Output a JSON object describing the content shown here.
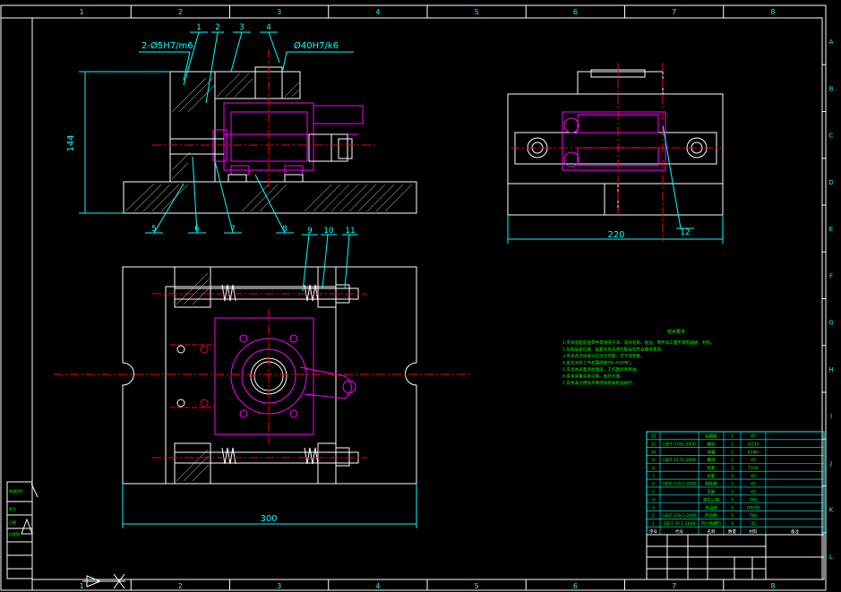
{
  "colors": {
    "background": "#000000",
    "outline": "#ffffff",
    "dimension": "#00ffff",
    "centerline": "#ff0000",
    "part": "#ff00ff",
    "notes": "#00ff00",
    "titleblock": "#00ffff"
  },
  "border_zones": {
    "columns": [
      "1",
      "2",
      "3",
      "4",
      "5",
      "6",
      "7",
      "8"
    ],
    "rows": [
      "A",
      "B",
      "C",
      "D",
      "E",
      "F",
      "G",
      "H",
      "I",
      "J",
      "K",
      "L"
    ]
  },
  "front_view": {
    "fit_left": "2-Ø5H7/m6",
    "fit_right": "Ø40H7/k6",
    "height_dim": "144",
    "balloons_top": [
      "1",
      "2",
      "3",
      "4"
    ],
    "balloons_bottom": [
      "5",
      "6",
      "7",
      "8"
    ]
  },
  "plan_view": {
    "width_dim": "300",
    "balloons": [
      "9",
      "10",
      "11"
    ]
  },
  "side_view": {
    "width_dim": "220",
    "balloon": "12"
  },
  "technical_notes": {
    "title": "技术要求",
    "lines": [
      "1.夹具装配前各零件需清洗干净，去除毛刺、锐边，零件加工面不得有磕碰、划伤。",
      "2.装配后定位销、钻套与夹具体的配合应符合图示要求。",
      "3.夹具各活动部分应灵活可靠，无卡滞现象。",
      "4.定位元件工作表面硬度58~62HRC。",
      "5.夹具体表面涂防锈漆，工作面涂防锈油。",
      "6.夹紧装置夹紧可靠，松开方便。",
      "7.其余未注明技术要求按有关标准执行。"
    ]
  },
  "parts_list": {
    "rows": [
      [
        "12",
        "",
        "钻模板",
        "1",
        "45",
        ""
      ],
      [
        "11",
        "GB/T 5782-2000",
        "螺栓",
        "2",
        "Q235",
        ""
      ],
      [
        "10",
        "",
        "弹簧",
        "2",
        "65Mn",
        ""
      ],
      [
        "9",
        "GB/T 6170-2000",
        "螺母",
        "2",
        "45",
        ""
      ],
      [
        "8",
        "",
        "钻套",
        "1",
        "T10A",
        ""
      ],
      [
        "7",
        "",
        "衬套",
        "1",
        "45",
        ""
      ],
      [
        "6",
        "GB/T 119.1-2000",
        "圆柱销",
        "2",
        "45",
        ""
      ],
      [
        "5",
        "",
        "压板",
        "2",
        "45",
        ""
      ],
      [
        "4",
        "",
        "定位心轴",
        "1",
        "T8A",
        ""
      ],
      [
        "3",
        "",
        "夹具体",
        "1",
        "HT200",
        ""
      ],
      [
        "2",
        "GB/T 119.1-2000",
        "削边销",
        "1",
        "T8A",
        ""
      ],
      [
        "1",
        "GB/T 70.1-2008",
        "内六角螺钉",
        "4",
        "35",
        ""
      ]
    ],
    "header": [
      "序号",
      "代号",
      "名称",
      "数量",
      "材料",
      "备注"
    ]
  },
  "left_stamp": [
    "借通用件",
    "旧底图",
    "签字",
    "日期"
  ]
}
